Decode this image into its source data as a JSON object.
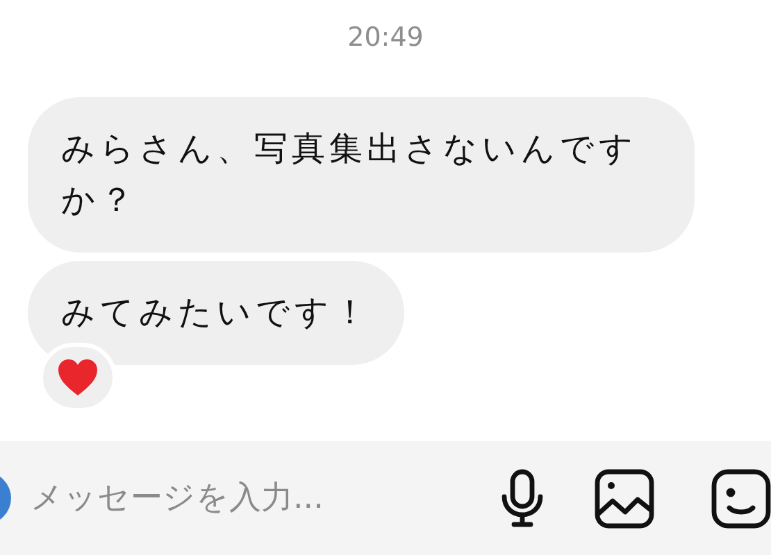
{
  "timestamp": "20:49",
  "messages": [
    {
      "text": "みらさん、写真集出さないんですか？"
    },
    {
      "text": "みてみたいです！",
      "heart_reaction": true
    }
  ],
  "composer": {
    "placeholder": "メッセージを入力..."
  }
}
